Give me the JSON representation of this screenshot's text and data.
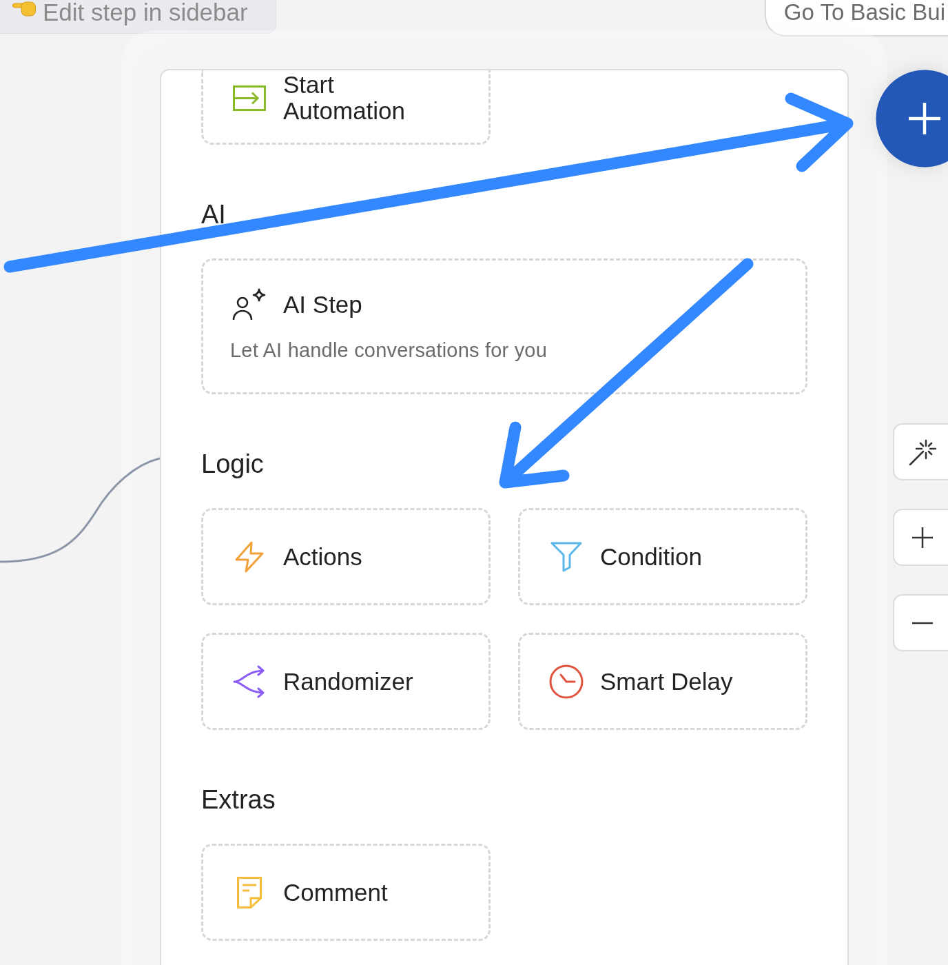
{
  "hint": {
    "text": "Edit step in sidebar"
  },
  "basic_builder_button": {
    "label": "Go To Basic Bui"
  },
  "steps_panel": {
    "sections": [
      {
        "items": [
          {
            "kind": "start",
            "title": "Start Automation"
          }
        ]
      },
      {
        "heading": "AI",
        "items": [
          {
            "kind": "ai",
            "title": "AI Step",
            "description": "Let AI handle conversations for you"
          }
        ]
      },
      {
        "heading": "Logic",
        "items": [
          {
            "kind": "actions",
            "title": "Actions"
          },
          {
            "kind": "condition",
            "title": "Condition"
          },
          {
            "kind": "randomizer",
            "title": "Randomizer"
          },
          {
            "kind": "delay",
            "title": "Smart Delay"
          }
        ]
      },
      {
        "heading": "Extras",
        "items": [
          {
            "kind": "comment",
            "title": "Comment"
          }
        ]
      }
    ]
  },
  "canvas_controls": [
    {
      "kind": "magic"
    },
    {
      "kind": "zoom_in"
    },
    {
      "kind": "zoom_out"
    }
  ]
}
